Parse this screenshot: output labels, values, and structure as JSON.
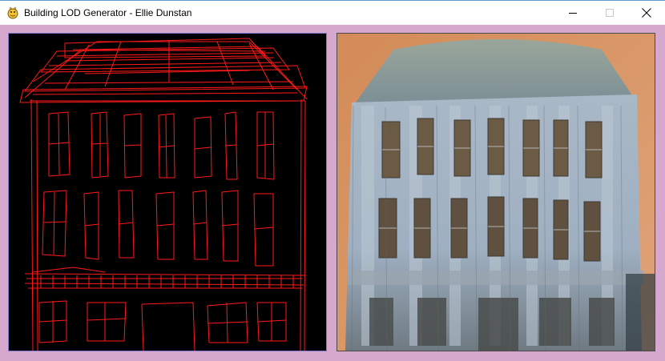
{
  "window": {
    "title": "Building LOD Generator - Ellie Dunstan",
    "app_icon": "pygame-snake-icon",
    "background_color": "#d7a8ce"
  },
  "controls": {
    "minimize_icon": "minimize-icon",
    "maximize_icon": "maximize-icon",
    "close_icon": "close-icon"
  },
  "canvas": {
    "background_color": "#000000",
    "stroke_color": "#ff1a1a"
  },
  "output": {
    "sky_color": "#d99a6c",
    "facade_color": "#a9b8c8"
  }
}
